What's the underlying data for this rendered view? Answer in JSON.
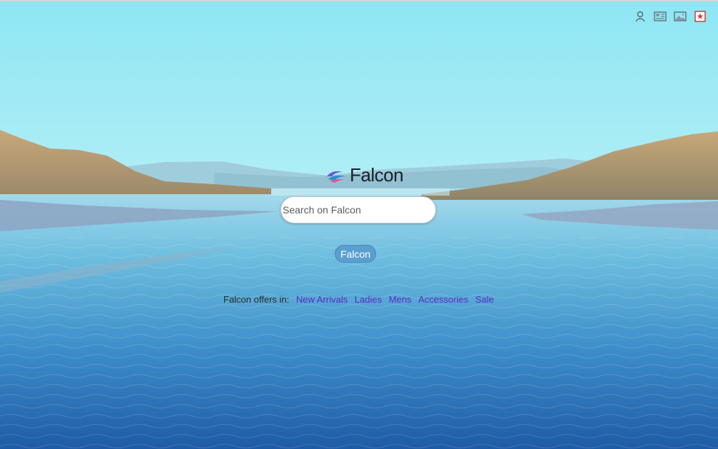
{
  "header": {
    "icons": [
      "user-icon",
      "news-icon",
      "image-icon",
      "bookmark-star-icon"
    ]
  },
  "logo": {
    "text": "Falcon"
  },
  "search": {
    "placeholder": "Search on Falcon",
    "value": "",
    "button_label": "Falcon"
  },
  "offers": {
    "prefix": "Falcon offers in:",
    "links": [
      "New Arrivals",
      "Ladies",
      "Mens",
      "Accessories",
      "Sale"
    ]
  },
  "colors": {
    "accent": "#5b9fd0",
    "link": "#5a2bc4",
    "star_icon": "#d9363e"
  }
}
